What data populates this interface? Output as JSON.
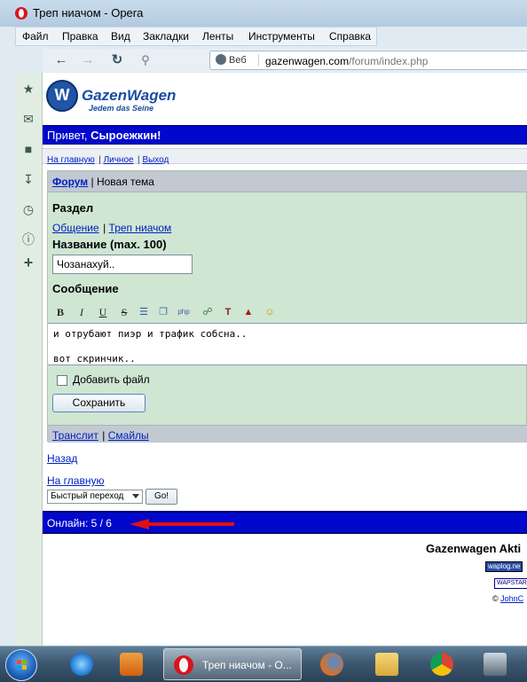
{
  "window": {
    "title": "Треп ниачом - Opera"
  },
  "menubar": {
    "items": [
      "Файл",
      "Правка",
      "Вид",
      "Закладки",
      "Ленты",
      "Инструменты",
      "Справка"
    ]
  },
  "toolbar": {
    "back_icon": "back-arrow-icon",
    "forward_icon": "forward-arrow-icon",
    "reload_icon": "reload-icon",
    "key_icon": "key-icon",
    "address": {
      "badge": "Веб",
      "host": "gazenwagen.com",
      "path": "/forum/index.php"
    }
  },
  "sidepanel": {
    "icons": [
      "star-icon",
      "mail-icon",
      "note-icon",
      "download-icon",
      "history-icon",
      "info-icon",
      "add-icon"
    ]
  },
  "page": {
    "logo": {
      "name": "GazenWagen",
      "slogan": "Jedem das Seine"
    },
    "greeting": {
      "prefix": "Привет, ",
      "user": "Сыроежкин!"
    },
    "nav_links": [
      "На главную",
      "Личное",
      "Выход"
    ],
    "breadcrumb": {
      "forum": "Форум",
      "current": "Новая тема"
    },
    "section": {
      "label": "Раздел",
      "categories": [
        "Общение",
        "Треп ниачом"
      ]
    },
    "title_field": {
      "label": "Название (max. 100)",
      "value": "Чозанахуй.."
    },
    "message": {
      "label": "Сообщение",
      "lines": [
        "и отрубают пиэр и трафик собсна..",
        "",
        "вот скринчик.."
      ]
    },
    "attach": {
      "label": "Добавить файл",
      "checked": false
    },
    "save_button": "Сохранить",
    "footer_links": [
      "Транслит",
      "Смайлы"
    ],
    "back_link": "Назад",
    "home_link": "На главную",
    "quick_nav": {
      "selected": "Быстрый переход",
      "go": "Go!"
    },
    "online": "Онлайн: 5 / 6",
    "site_footer": {
      "title": "Gazenwagen Akti",
      "counters": [
        "waplog.ne",
        "WAPSTAR"
      ],
      "copyright_prefix": "© ",
      "copyright_name": "JohnC"
    }
  },
  "taskbar": {
    "active_title": "Треп ниачом - О..."
  },
  "colors": {
    "banner": "#0008cc",
    "forum_box": "#cfe6d3",
    "link": "#0021c3",
    "annotation_arrow": "#e01010"
  }
}
